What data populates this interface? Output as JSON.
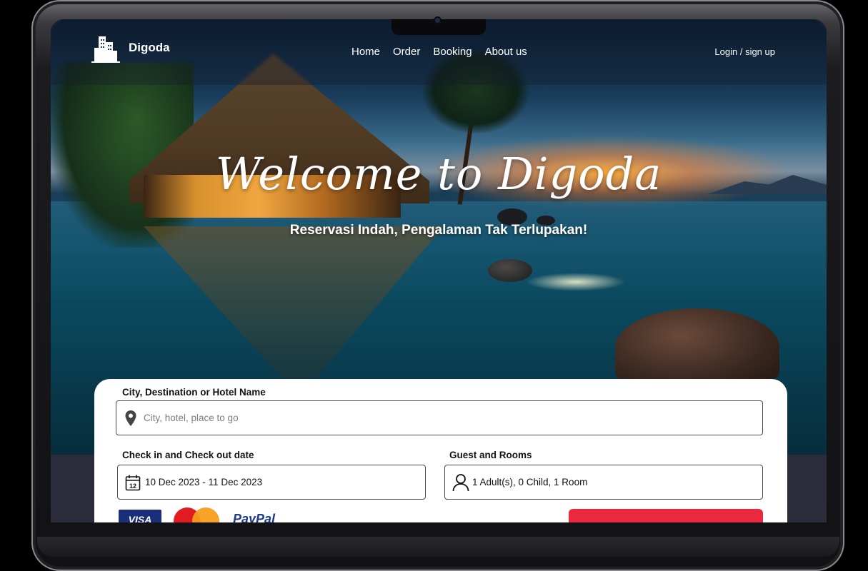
{
  "nav": {
    "brand": "Digoda",
    "links": [
      "Home",
      "Order",
      "Booking",
      "About us"
    ],
    "login": "Login / sign up"
  },
  "hero": {
    "welcome": "Welcome to Digoda",
    "tagline": "Reservasi Indah, Pengalaman Tak Terlupakan!"
  },
  "search": {
    "destination_label": "City, Destination or Hotel Name",
    "destination_placeholder": "City, hotel, place to go",
    "dates_label": "Check in and Check out date",
    "dates_value": "10 Dec 2023 - 11 Dec 2023",
    "guests_label": "Guest and Rooms",
    "guests_value": "1 Adult(s), 0 Child, 1 Room",
    "calendar_day": "12"
  },
  "payments": {
    "visa": "VISA",
    "paypal": "PayPal"
  },
  "icons": [
    "building-icon",
    "location-pin-icon",
    "calendar-icon",
    "user-icon"
  ],
  "colors": {
    "accent": "#ec2740",
    "card": "#ffffff"
  }
}
